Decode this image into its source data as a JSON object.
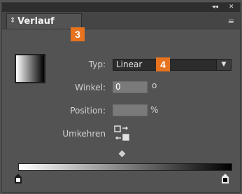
{
  "titlebar": {
    "collapse_glyph": "◂◂",
    "close_glyph": "✕"
  },
  "panel": {
    "tab_arrows_glyph": "⇕",
    "title": "Verlauf",
    "badge_left": "3",
    "menu_glyph": "≡"
  },
  "form": {
    "type_label": "Typ:",
    "type_value": "Linear",
    "type_arrow": "▼",
    "badge_right": "4",
    "angle_label": "Winkel:",
    "angle_value": "0",
    "angle_unit": "o",
    "position_label": "Position:",
    "position_value": "",
    "position_unit": "%",
    "reverse_label": "Umkehren"
  },
  "gradient": {
    "start_color": "#ffffff",
    "end_color": "#000000",
    "stops": [
      {
        "color": "#ffffff",
        "location_percent": 0
      },
      {
        "color": "#000000",
        "location_percent": 100
      }
    ],
    "midpoint_percent": 50
  },
  "colors": {
    "panel_bg": "#535353",
    "accent_badge": "#e8731e",
    "field_bg": "#7a7a7a",
    "dropdown_bg": "#2c2c2c"
  },
  "icons": {
    "collapse": "double-chevron-left-icon",
    "close": "close-icon",
    "tab_arrows": "up-down-arrows-icon",
    "panel_menu": "panel-menu-icon",
    "reverse": "reverse-gradient-icon",
    "dropdown": "chevron-down-icon"
  }
}
